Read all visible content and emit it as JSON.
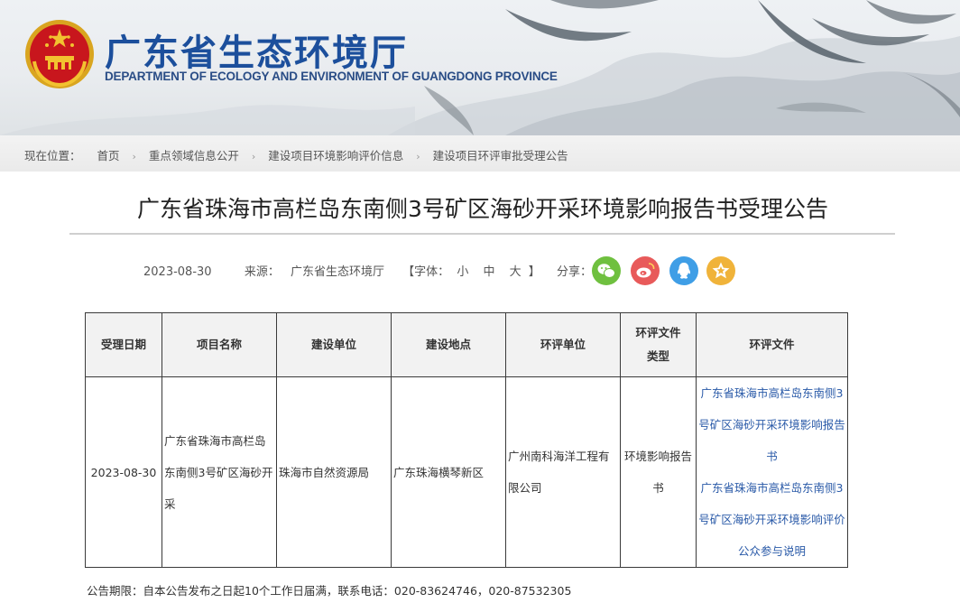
{
  "header": {
    "site_title": "广东省生态环境厅",
    "site_subtitle": "DEPARTMENT OF ECOLOGY AND ENVIRONMENT OF GUANGDONG PROVINCE"
  },
  "breadcrumb": {
    "prefix": "现在位置：",
    "items": [
      "首页",
      "重点领域信息公开",
      "建设项目环境影响评价信息",
      "建设项目环评审批受理公告"
    ]
  },
  "article": {
    "title": "广东省珠海市高栏岛东南侧3号矿区海砂开采环境影响报告书受理公告",
    "date": "2023-08-30",
    "source_label": "来源：",
    "source": "广东省生态环境厅",
    "font_label": "【字体：",
    "font_small": "小",
    "font_medium": "中",
    "font_large": "大",
    "font_close": "】",
    "share_label": "分享："
  },
  "share": {
    "wechat_color": "#6fc03f",
    "weibo_color": "#e85a5a",
    "qq_color": "#3f9ee6",
    "favorite_color": "#f0b33a"
  },
  "table": {
    "headers": [
      "受理日期",
      "项目名称",
      "建设单位",
      "建设地点",
      "环评单位",
      "环评文件类型",
      "环评文件"
    ],
    "header_type_line1": "环评文件",
    "header_type_line2": "类型",
    "row": {
      "date": "2023-08-30",
      "project": "广东省珠海市高栏岛东南侧3号矿区海砂开采",
      "builder": "珠海市自然资源局",
      "location": "广东珠海横琴新区",
      "eia_unit": "广州南科海洋工程有限公司",
      "doc_type": "环境影响报告书",
      "files": [
        "广东省珠海市高栏岛东南侧3号矿区海砂开采环境影响报告书",
        "广东省珠海市高栏岛东南侧3号矿区海砂开采环境影响评价公众参与说明"
      ]
    }
  },
  "footer": {
    "note": "公告期限：自本公告发布之日起10个工作日届满，联系电话：020-83624746，020-87532305"
  }
}
